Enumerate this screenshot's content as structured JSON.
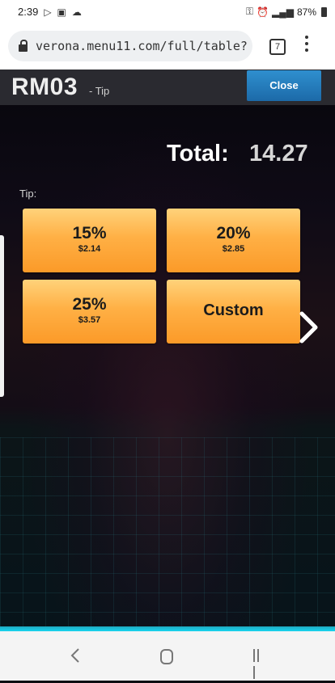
{
  "status_bar": {
    "time": "2:39",
    "battery": "87%"
  },
  "browser": {
    "url": "verona.menu11.com/full/table?x=",
    "tab_count": "7"
  },
  "header": {
    "table_code": "RM03",
    "subtitle": "- Tip",
    "close_label": "Close"
  },
  "total": {
    "label": "Total:",
    "value": "14.27"
  },
  "tip": {
    "label": "Tip:",
    "options": [
      {
        "percent": "15%",
        "amount": "$2.14"
      },
      {
        "percent": "20%",
        "amount": "$2.85"
      },
      {
        "percent": "25%",
        "amount": "$3.57"
      }
    ],
    "custom_label": "Custom"
  },
  "colors": {
    "button_orange": "#ffb045",
    "close_blue": "#1c6aa8",
    "header_bg": "#2a2a30"
  },
  "icons": [
    "lock-icon",
    "tab-count-icon",
    "kebab-menu-icon",
    "next-arrow-icon",
    "nav-back-icon",
    "nav-home-icon",
    "nav-recents-icon"
  ]
}
